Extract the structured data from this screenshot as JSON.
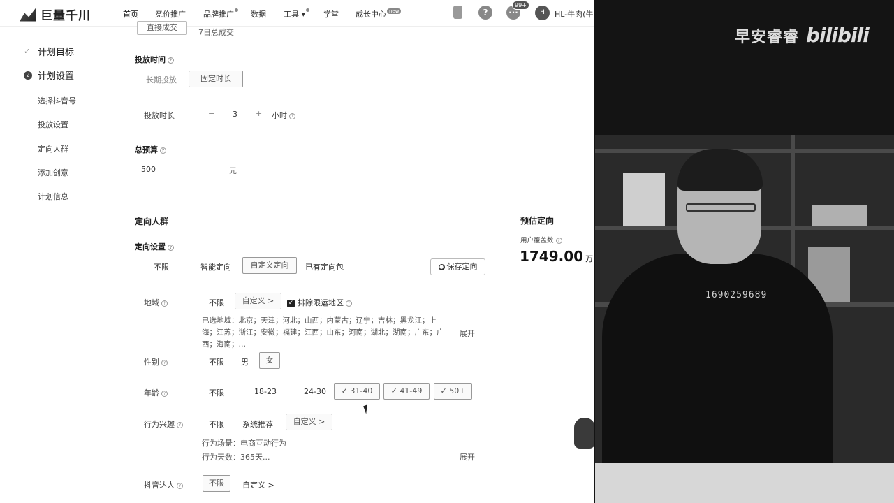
{
  "nav": {
    "logo": "巨量千川",
    "items": [
      "首页",
      "竞价推广",
      "品牌推广",
      "数据",
      "工具",
      "学堂",
      "成长中心"
    ],
    "growth_badge": "new",
    "msg_badge": "99+",
    "avatar": "H",
    "user": "HL-牛肉(牛"
  },
  "sidebar": {
    "steps": [
      {
        "label": "计划目标",
        "state": "done"
      },
      {
        "label": "计划设置",
        "num": "2"
      }
    ],
    "subs": [
      "选择抖音号",
      "投放设置",
      "定向人群",
      "添加创意",
      "计划信息"
    ]
  },
  "schedule": {
    "top_partial_btn": "直接成交",
    "top_partial_text": "7日总成交",
    "title": "投放时间",
    "opt_long": "长期投放",
    "opt_fixed": "固定时长",
    "dur_label": "投放时长",
    "minus": "−",
    "value": "3",
    "plus": "+",
    "unit": "小时"
  },
  "budget": {
    "title": "总预算",
    "value": "500",
    "unit": "元"
  },
  "targeting": {
    "section_title": "定向人群",
    "setting_label": "定向设置",
    "setting_opts": [
      "不限",
      "智能定向",
      "自定义定向",
      "已有定向包"
    ],
    "save_btn": "保存定向",
    "region": {
      "label": "地域",
      "opt_none": "不限",
      "custom": "自定义 >",
      "exclude": "排除限运地区",
      "selected": "已选地域：北京；天津；河北；山西；内蒙古；辽宁；吉林；黑龙江；上海；江苏；浙江；安徽；福建；江西；山东；河南；湖北；湖南；广东；广西；海南；…",
      "expand": "展开"
    },
    "gender": {
      "label": "性别",
      "opts": [
        "不限",
        "男",
        "女"
      ]
    },
    "age": {
      "label": "年龄",
      "opts": [
        "不限",
        "18-23",
        "24-30"
      ],
      "checked": [
        "31-40",
        "41-49",
        "50+"
      ]
    },
    "interest": {
      "label": "行为兴趣",
      "opts": [
        "不限",
        "系统推荐"
      ],
      "custom": "自定义 >",
      "scene": "行为场景：电商互动行为",
      "days": "行为天数：365天...",
      "expand": "展开"
    },
    "douyin": {
      "label": "抖音达人",
      "opt_none": "不限",
      "custom": "自定义 >"
    }
  },
  "estimate": {
    "title": "预估定向",
    "sub": "用户覆盖数",
    "value": "1749.00",
    "unit": "万"
  },
  "overlay": {
    "channel": "早安睿睿",
    "brand": "bilibili",
    "cam_text": "1690259689"
  }
}
